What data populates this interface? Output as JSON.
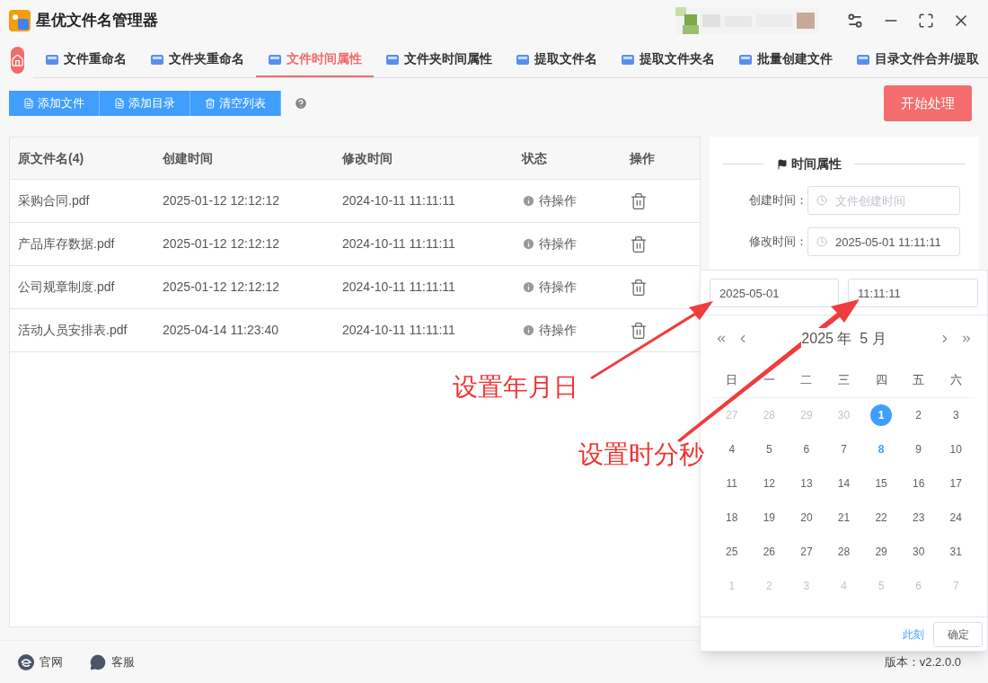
{
  "window": {
    "title": "星优文件名管理器"
  },
  "tabs": [
    {
      "label": "文件重命名",
      "selected": false
    },
    {
      "label": "文件夹重命名",
      "selected": false
    },
    {
      "label": "文件时间属性",
      "selected": true
    },
    {
      "label": "文件夹时间属性",
      "selected": false
    },
    {
      "label": "提取文件名",
      "selected": false
    },
    {
      "label": "提取文件夹名",
      "selected": false
    },
    {
      "label": "批量创建文件",
      "selected": false
    },
    {
      "label": "目录文件合并/提取",
      "selected": false
    }
  ],
  "toolbar": {
    "buttons": [
      {
        "label": "添加文件",
        "kind": "file"
      },
      {
        "label": "添加目录",
        "kind": "file"
      },
      {
        "label": "清空列表",
        "kind": "trash"
      }
    ],
    "start_button": "开始处理"
  },
  "table": {
    "columns": [
      "原文件名(4)",
      "创建时间",
      "修改时间",
      "状态",
      "操作"
    ],
    "rows": [
      {
        "name": "采购合同.pdf",
        "created": "2025-01-12 12:12:12",
        "modified": "2024-10-11 11:11:11",
        "status": "待操作"
      },
      {
        "name": "产品库存数据.pdf",
        "created": "2025-01-12 12:12:12",
        "modified": "2024-10-11 11:11:11",
        "status": "待操作"
      },
      {
        "name": "公司规章制度.pdf",
        "created": "2025-01-12 12:12:12",
        "modified": "2024-10-11 11:11:11",
        "status": "待操作"
      },
      {
        "name": "活动人员安排表.pdf",
        "created": "2025-04-14 11:23:40",
        "modified": "2024-10-11 11:11:11",
        "status": "待操作"
      }
    ]
  },
  "panel": {
    "title": "时间属性",
    "fields": [
      {
        "label": "创建时间：",
        "placeholder": "文件创建时间"
      },
      {
        "label": "修改时间：",
        "value": "2025-05-01 11:11:11"
      }
    ]
  },
  "picker": {
    "date": "2025-05-01",
    "time": "11:11:11",
    "month_title": "2025 年  5 月",
    "weekdays": [
      "日",
      "一",
      "二",
      "三",
      "四",
      "五",
      "六"
    ],
    "weeks": [
      [
        {
          "d": "27",
          "muted": true,
          "selected": false,
          "today": false
        },
        {
          "d": "28",
          "muted": true,
          "selected": false,
          "today": false
        },
        {
          "d": "29",
          "muted": true,
          "selected": false,
          "today": false
        },
        {
          "d": "30",
          "muted": true,
          "selected": false,
          "today": false
        },
        {
          "d": "1",
          "muted": false,
          "selected": true,
          "today": false
        },
        {
          "d": "2",
          "muted": false,
          "selected": false,
          "today": false
        },
        {
          "d": "3",
          "muted": false,
          "selected": false,
          "today": false
        }
      ],
      [
        {
          "d": "4",
          "muted": false,
          "selected": false,
          "today": false
        },
        {
          "d": "5",
          "muted": false,
          "selected": false,
          "today": false
        },
        {
          "d": "6",
          "muted": false,
          "selected": false,
          "today": false
        },
        {
          "d": "7",
          "muted": false,
          "selected": false,
          "today": false
        },
        {
          "d": "8",
          "muted": false,
          "selected": false,
          "today": true
        },
        {
          "d": "9",
          "muted": false,
          "selected": false,
          "today": false
        },
        {
          "d": "10",
          "muted": false,
          "selected": false,
          "today": false
        }
      ],
      [
        {
          "d": "11",
          "muted": false,
          "selected": false,
          "today": false
        },
        {
          "d": "12",
          "muted": false,
          "selected": false,
          "today": false
        },
        {
          "d": "13",
          "muted": false,
          "selected": false,
          "today": false
        },
        {
          "d": "14",
          "muted": false,
          "selected": false,
          "today": false
        },
        {
          "d": "15",
          "muted": false,
          "selected": false,
          "today": false
        },
        {
          "d": "16",
          "muted": false,
          "selected": false,
          "today": false
        },
        {
          "d": "17",
          "muted": false,
          "selected": false,
          "today": false
        }
      ],
      [
        {
          "d": "18",
          "muted": false,
          "selected": false,
          "today": false
        },
        {
          "d": "19",
          "muted": false,
          "selected": false,
          "today": false
        },
        {
          "d": "20",
          "muted": false,
          "selected": false,
          "today": false
        },
        {
          "d": "21",
          "muted": false,
          "selected": false,
          "today": false
        },
        {
          "d": "22",
          "muted": false,
          "selected": false,
          "today": false
        },
        {
          "d": "23",
          "muted": false,
          "selected": false,
          "today": false
        },
        {
          "d": "24",
          "muted": false,
          "selected": false,
          "today": false
        }
      ],
      [
        {
          "d": "25",
          "muted": false,
          "selected": false,
          "today": false
        },
        {
          "d": "26",
          "muted": false,
          "selected": false,
          "today": false
        },
        {
          "d": "27",
          "muted": false,
          "selected": false,
          "today": false
        },
        {
          "d": "28",
          "muted": false,
          "selected": false,
          "today": false
        },
        {
          "d": "29",
          "muted": false,
          "selected": false,
          "today": false
        },
        {
          "d": "30",
          "muted": false,
          "selected": false,
          "today": false
        },
        {
          "d": "31",
          "muted": false,
          "selected": false,
          "today": false
        }
      ],
      [
        {
          "d": "1",
          "muted": true,
          "selected": false,
          "today": false
        },
        {
          "d": "2",
          "muted": true,
          "selected": false,
          "today": false
        },
        {
          "d": "3",
          "muted": true,
          "selected": false,
          "today": false
        },
        {
          "d": "4",
          "muted": true,
          "selected": false,
          "today": false
        },
        {
          "d": "5",
          "muted": true,
          "selected": false,
          "today": false
        },
        {
          "d": "6",
          "muted": true,
          "selected": false,
          "today": false
        },
        {
          "d": "7",
          "muted": true,
          "selected": false,
          "today": false
        }
      ]
    ],
    "now_link": "此刻",
    "ok_button": "确定"
  },
  "annotations": [
    "设置年月日",
    "设置时分秒"
  ],
  "footer": {
    "links": [
      {
        "label": "官网",
        "kind": "web"
      },
      {
        "label": "客服",
        "kind": "chat"
      }
    ],
    "version": "版本：v2.2.0.0"
  }
}
